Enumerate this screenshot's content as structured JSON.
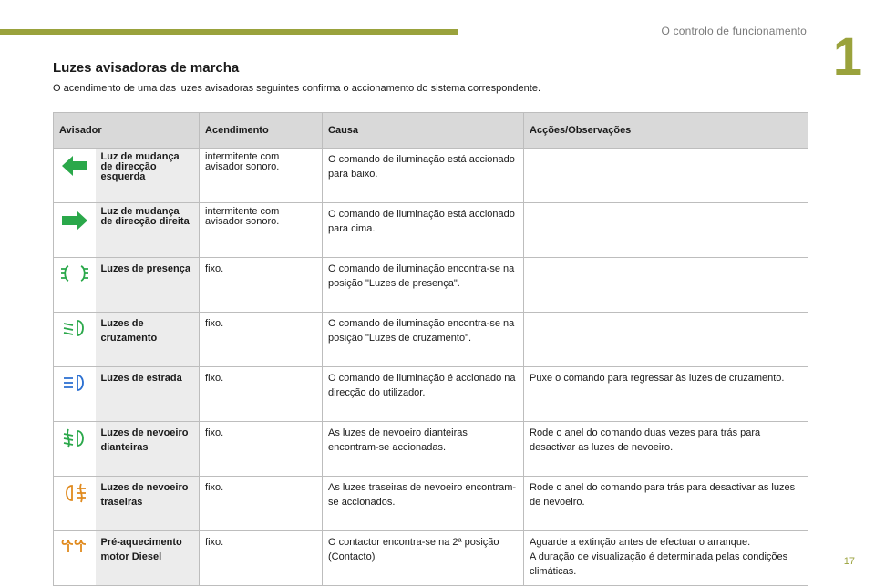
{
  "header": {
    "chapter_title": "O controlo de funcionamento",
    "chapter_number": "1"
  },
  "section": {
    "title": "Luzes avisadoras de marcha",
    "intro": "O acendimento de uma das luzes avisadoras seguintes confirma o accionamento do sistema correspondente."
  },
  "table": {
    "headers": [
      "Avisador",
      "Acendimento",
      "Causa",
      "Acções/Observações"
    ],
    "rows": [
      {
        "icon": "left-turn-arrow-icon",
        "icon_color": "#2aa84a",
        "name": "Luz de mudança de direcção esquerda",
        "lighting": "intermitente com avisador sonoro.",
        "cause": "O comando de iluminação está accionado para baixo.",
        "action": ""
      },
      {
        "icon": "right-turn-arrow-icon",
        "icon_color": "#2aa84a",
        "name": "Luz de mudança de direcção direita",
        "lighting": "intermitente com avisador sonoro.",
        "cause": "O comando de iluminação está accionado para cima.",
        "action": ""
      },
      {
        "icon": "side-lights-icon",
        "icon_color": "#2aa84a",
        "name": "Luzes de presença",
        "lighting": "fixo.",
        "cause": "O comando de iluminação encontra-se na posição \"Luzes de presença\".",
        "action": ""
      },
      {
        "icon": "dipped-beam-icon",
        "icon_color": "#2aa84a",
        "name": "Luzes de cruzamento",
        "lighting": "fixo.",
        "cause": "O comando de iluminação encontra-se na posição \"Luzes de cruzamento\".",
        "action": ""
      },
      {
        "icon": "main-beam-icon",
        "icon_color": "#2a6fd1",
        "name": "Luzes de estrada",
        "lighting": "fixo.",
        "cause": "O comando de iluminação é accionado na direcção do utilizador.",
        "action": "Puxe o comando para regressar às luzes de cruzamento."
      },
      {
        "icon": "front-fog-lamp-icon",
        "icon_color": "#2aa84a",
        "name": "Luzes de nevoeiro dianteiras",
        "lighting": "fixo.",
        "cause": "As luzes de nevoeiro dianteiras encontram-se accionadas.",
        "action": "Rode o anel do comando duas vezes para trás para desactivar as luzes de nevoeiro."
      },
      {
        "icon": "rear-fog-lamp-icon",
        "icon_color": "#e08a1e",
        "name": "Luzes de nevoeiro traseiras",
        "lighting": "fixo.",
        "cause": "As luzes traseiras de nevoeiro encontram-se accionados.",
        "action": "Rode o anel do comando para trás para desactivar as luzes de nevoeiro."
      },
      {
        "icon": "diesel-preheating-icon",
        "icon_color": "#e08a1e",
        "name": "Pré-aquecimento motor Diesel",
        "lighting": "fixo.",
        "cause": "O contactor encontra-se na 2ª posição (Contacto)",
        "action": "Aguarde a extinção antes de efectuar o arranque.\nA duração de visualização é determinada pelas condições climáticas."
      }
    ]
  },
  "footer": {
    "page_number": "17"
  }
}
